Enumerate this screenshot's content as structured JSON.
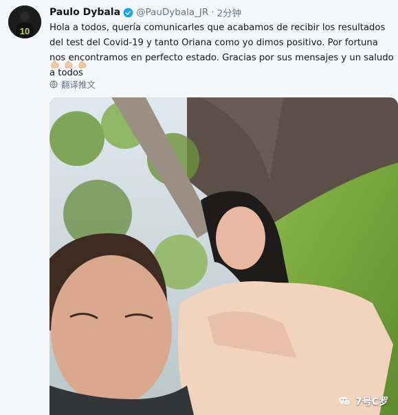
{
  "tweet": {
    "author": {
      "display_name": "Paulo Dybala",
      "handle": "@PauDybala_JR",
      "verified": true
    },
    "separator": "·",
    "time": "2分钟",
    "text": "Hola a todos, quería comunicarles que acabamos de recibir los resultados del test del Covid-19 y tanto Oriana como yo dimos positivo. Por fortuna nos encontramos en perfecto estado. Gracias por sus mensajes y un saludo a todos",
    "emojis": [
      "flexed-biceps",
      "flexed-biceps",
      "flexed-biceps"
    ],
    "translate_label": "翻译推文",
    "watermark": "7号C罗"
  },
  "colors": {
    "accent": "#1da1f2",
    "muted": "#657786",
    "text": "#14171a"
  }
}
